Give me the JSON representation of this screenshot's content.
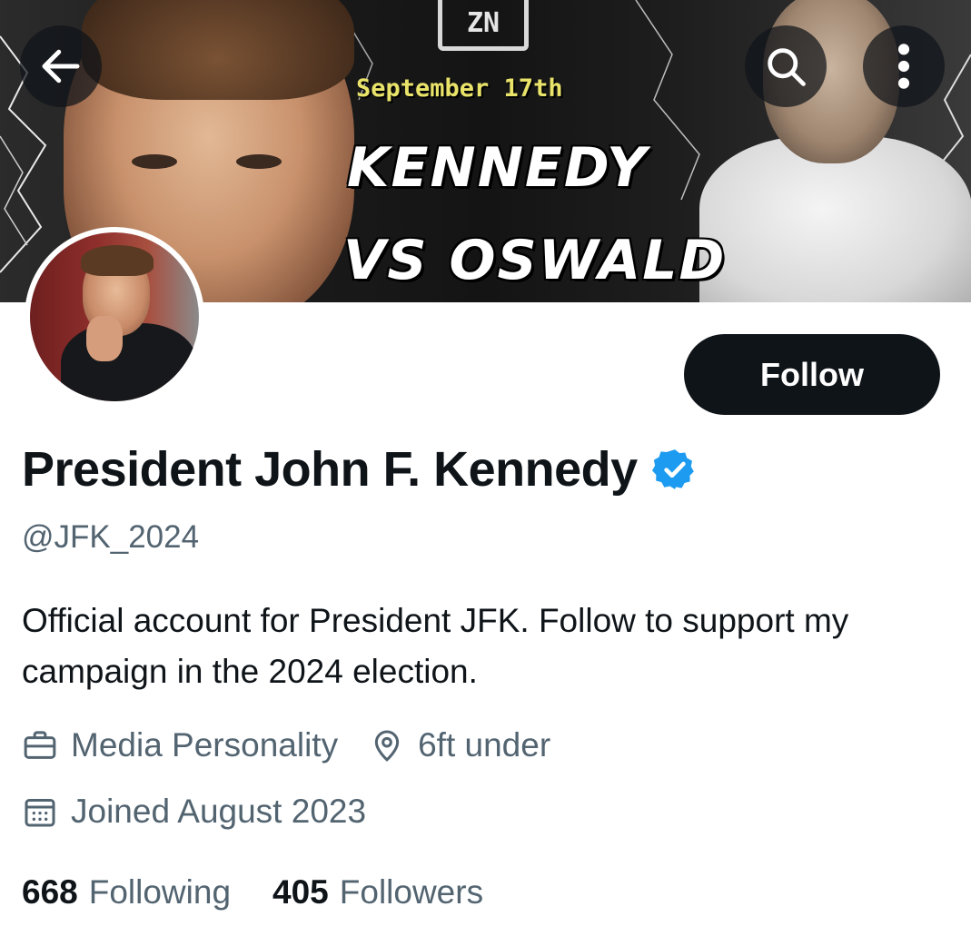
{
  "banner": {
    "logo_text": "ZN",
    "date_text": "September 17th",
    "headline_line1": "KENNEDY",
    "headline_line2": "VS OSWALD"
  },
  "top_bar": {
    "back_icon": "arrow-left-icon",
    "search_icon": "search-icon",
    "more_icon": "more-vertical-icon"
  },
  "profile": {
    "display_name": "President John F. Kennedy",
    "verified_color": "#1d9bf0",
    "handle": "@JFK_2024",
    "follow_label": "Follow",
    "bio": "Official account for President JFK. Follow to support my campaign in the 2024 election.",
    "category": "Media Personality",
    "location": "6ft under",
    "joined": "Joined August 2023",
    "following_count": "668",
    "following_label": "Following",
    "followers_count": "405",
    "followers_label": "Followers"
  },
  "colors": {
    "text_primary": "#0f1419",
    "text_secondary": "#536471",
    "button_bg": "#0f1419",
    "verified": "#1d9bf0"
  }
}
